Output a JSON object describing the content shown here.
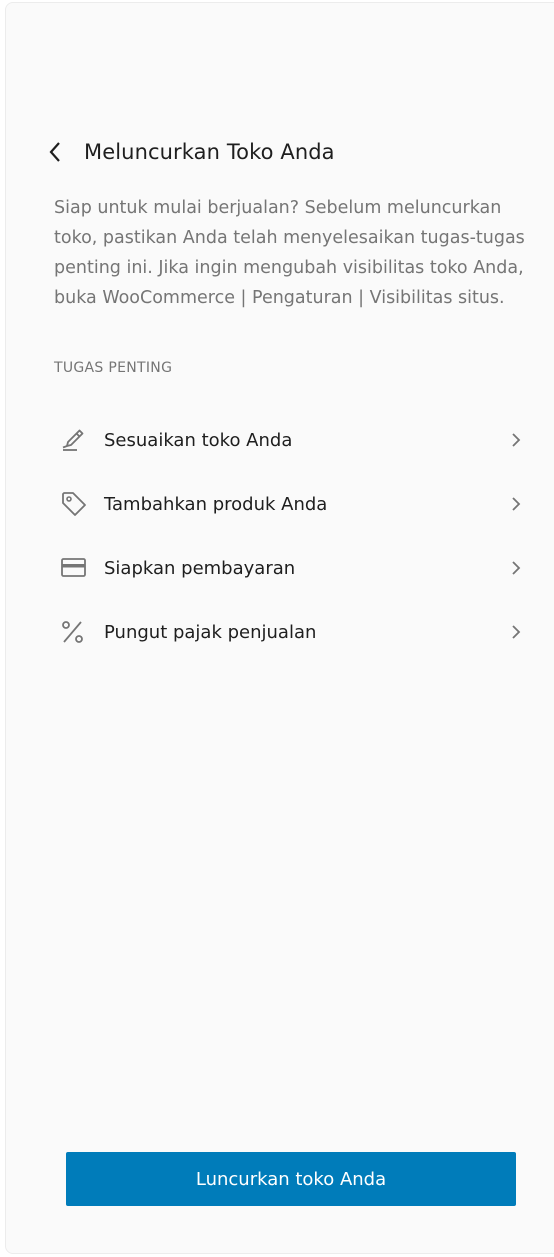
{
  "header": {
    "title": "Meluncurkan Toko Anda",
    "back_icon": "chevron-left-icon"
  },
  "description": "Siap untuk mulai berjualan? Sebelum meluncurkan toko, pastikan Anda telah menyelesaikan tugas-tugas penting ini. Jika ingin mengubah visibilitas toko Anda, buka WooCommerce | Pengaturan | Visibilitas situs.",
  "section": {
    "label": "TUGAS PENTING"
  },
  "tasks": [
    {
      "label": "Sesuaikan toko Anda",
      "icon": "brush-icon"
    },
    {
      "label": "Tambahkan produk Anda",
      "icon": "tag-icon"
    },
    {
      "label": "Siapkan pembayaran",
      "icon": "credit-card-icon"
    },
    {
      "label": "Pungut pajak penjualan",
      "icon": "percent-icon"
    }
  ],
  "launch_button": {
    "label": "Luncurkan toko Anda"
  },
  "colors": {
    "accent": "#007cba",
    "text_primary": "#1e1e1e",
    "text_secondary": "#757575",
    "panel_background": "#fafafa"
  }
}
